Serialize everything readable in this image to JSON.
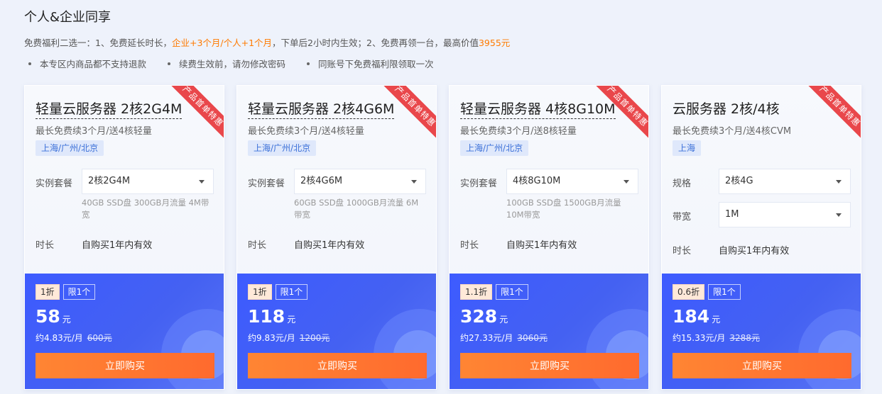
{
  "section": {
    "title": "个人&企业同享",
    "benefit_prefix": "免费福利二选一：1、免费延长时长，",
    "benefit_highlight": "企业+3个月/个人+1个月",
    "benefit_middle": "，下单后2小时内生效；2、免费再领一台，最高价值",
    "benefit_value": "3955元",
    "notes": [
      "本专区内商品都不支持退款",
      "续费生效前，请勿修改密码",
      "同账号下免费福利限领取一次"
    ]
  },
  "colors": {
    "accent_orange": "#ff7a00",
    "ribbon_red": "#e9474b",
    "panel_blue": "#4461f2",
    "buy_orange": "#ff6a2e"
  },
  "cards": [
    {
      "ribbon": "产品首单特惠",
      "title": "轻量云服务器 2核2G4M",
      "subtitle": "最长免费续3个月/送4核轻量",
      "region": "上海/广州/北京",
      "spec_label": "实例套餐",
      "spec_value": "2核2G4M",
      "spec_desc": "40GB SSD盘 300GB月流量 4M带宽",
      "duration_label": "时长",
      "duration_value": "自购买1年内有效",
      "discount": "1折",
      "limit": "限1个",
      "price": "58",
      "unit": "元",
      "per_month": "约4.83元/月",
      "original": "600元",
      "buy_label": "立即购买"
    },
    {
      "ribbon": "产品首单特惠",
      "title": "轻量云服务器 2核4G6M",
      "subtitle": "最长免费续3个月/送4核轻量",
      "region": "上海/广州/北京",
      "spec_label": "实例套餐",
      "spec_value": "2核4G6M",
      "spec_desc": "60GB SSD盘 1000GB月流量 6M带宽",
      "duration_label": "时长",
      "duration_value": "自购买1年内有效",
      "discount": "1折",
      "limit": "限1个",
      "price": "118",
      "unit": "元",
      "per_month": "约9.83元/月",
      "original": "1200元",
      "buy_label": "立即购买"
    },
    {
      "ribbon": "产品首单特惠",
      "title": "轻量云服务器 4核8G10M",
      "subtitle": "最长免费续3个月/送8核轻量",
      "region": "上海/广州/北京",
      "spec_label": "实例套餐",
      "spec_value": "4核8G10M",
      "spec_desc": "100GB SSD盘 1500GB月流量 10M带宽",
      "duration_label": "时长",
      "duration_value": "自购买1年内有效",
      "discount": "1.1折",
      "limit": "限1个",
      "price": "328",
      "unit": "元",
      "per_month": "约27.33元/月",
      "original": "3060元",
      "buy_label": "立即购买"
    },
    {
      "ribbon": "产品首单特惠",
      "title": "云服务器 2核/4核",
      "subtitle": "最长免费续3个月/送4核CVM",
      "region": "上海",
      "spec_label": "规格",
      "spec_value": "2核4G",
      "bandwidth_label": "带宽",
      "bandwidth_value": "1M",
      "duration_label": "时长",
      "duration_value": "自购买1年内有效",
      "discount": "0.6折",
      "limit": "限1个",
      "price": "184",
      "unit": "元",
      "per_month": "约15.33元/月",
      "original": "3288元",
      "buy_label": "立即购买"
    }
  ]
}
